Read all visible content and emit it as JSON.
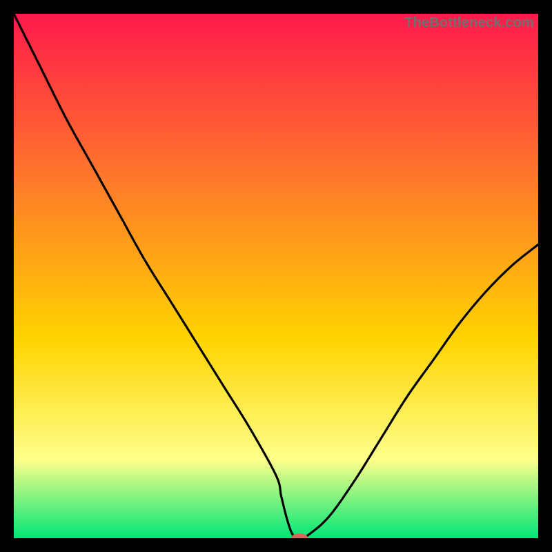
{
  "attribution": "TheBottleneck.com",
  "colors": {
    "top_gradient": "#ff1a4b",
    "mid1_gradient": "#ff7a2a",
    "mid2_gradient": "#ffd400",
    "lower_gradient": "#ffff8a",
    "bottom_gradient": "#00e676",
    "curve": "#000000",
    "marker": "#d86a5c",
    "background": "#000000"
  },
  "chart_data": {
    "type": "line",
    "title": "",
    "xlabel": "",
    "ylabel": "",
    "xlim": [
      0,
      100
    ],
    "ylim": [
      0,
      100
    ],
    "series": [
      {
        "name": "bottleneck-curve",
        "x": [
          0,
          5,
          10,
          15,
          20,
          25,
          30,
          35,
          40,
          45,
          50,
          51,
          52,
          53,
          54,
          55,
          56,
          60,
          65,
          70,
          75,
          80,
          85,
          90,
          95,
          100
        ],
        "values": [
          100,
          90,
          80,
          71,
          62,
          53,
          45,
          37,
          29,
          21,
          12,
          8,
          4,
          1,
          0,
          0,
          0.5,
          4,
          11,
          19,
          27,
          34,
          41,
          47,
          52,
          56
        ]
      }
    ],
    "marker": {
      "x": 54.5,
      "y": 0,
      "rx": 1.6,
      "ry": 0.9
    },
    "annotations": []
  }
}
